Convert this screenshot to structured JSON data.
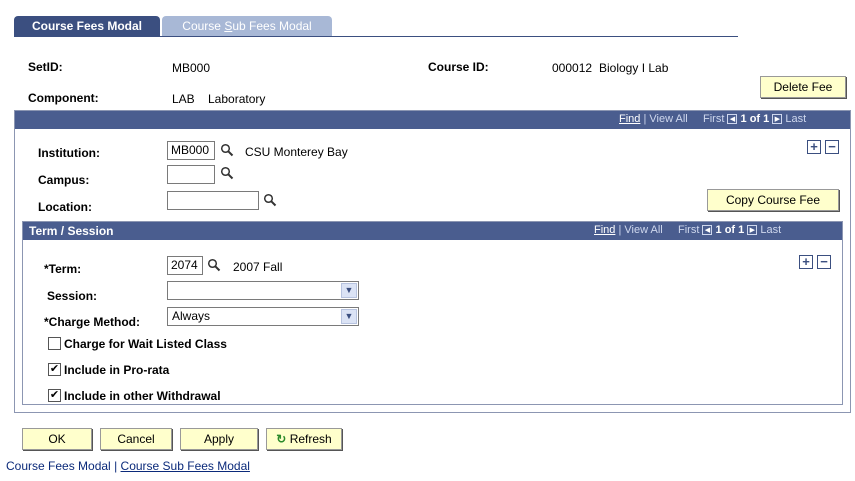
{
  "tabs": {
    "active": "Course Fees Modal",
    "inactive_prefix": "Course ",
    "inactive_underlined": "S",
    "inactive_suffix": "ub Fees Modal"
  },
  "header": {
    "setid_label": "SetID:",
    "setid_value": "MB000",
    "course_id_label": "Course ID:",
    "course_id_value": "000012",
    "course_name": "Biology I Lab",
    "component_label": "Component:",
    "component_value": "LAB",
    "component_desc": "Laboratory",
    "delete_fee_button": "Delete Fee"
  },
  "outer_grid": {
    "nav": {
      "find": "Find",
      "view_all": "View All",
      "first": "First",
      "count": "1 of 1",
      "last": "Last"
    },
    "institution_label": "Institution:",
    "institution_value": "MB000",
    "institution_desc": "CSU Monterey Bay",
    "campus_label": "Campus:",
    "campus_value": "",
    "location_label": "Location:",
    "location_value": "",
    "copy_course_fee_button": "Copy Course Fee"
  },
  "term_session": {
    "title": "Term / Session",
    "nav": {
      "find": "Find",
      "view_all": "View All",
      "first": "First",
      "count": "1 of 1",
      "last": "Last"
    },
    "term_label": "*Term:",
    "term_value": "2074",
    "term_desc": "2007 Fall",
    "session_label": "Session:",
    "session_value": "",
    "charge_method_label": "*Charge Method:",
    "charge_method_value": "Always",
    "checkboxes": [
      {
        "label": "Charge for Wait Listed Class",
        "checked": false
      },
      {
        "label": "Include in Pro-rata",
        "checked": true
      },
      {
        "label": "Include in other Withdrawal",
        "checked": true
      }
    ]
  },
  "actions": {
    "ok": "OK",
    "cancel": "Cancel",
    "apply": "Apply",
    "refresh": "Refresh"
  },
  "bottom_links": {
    "course_fees_modal": "Course Fees Modal",
    "separator": "|",
    "course_sub_fees_modal": "Course Sub Fees Modal"
  },
  "colors": {
    "band": "#4a5d8f",
    "tab_active": "#3b4f80",
    "tab_inactive": "#a8b8d6",
    "button_bg": "#ffffcc",
    "link": "#0b2a7a"
  }
}
